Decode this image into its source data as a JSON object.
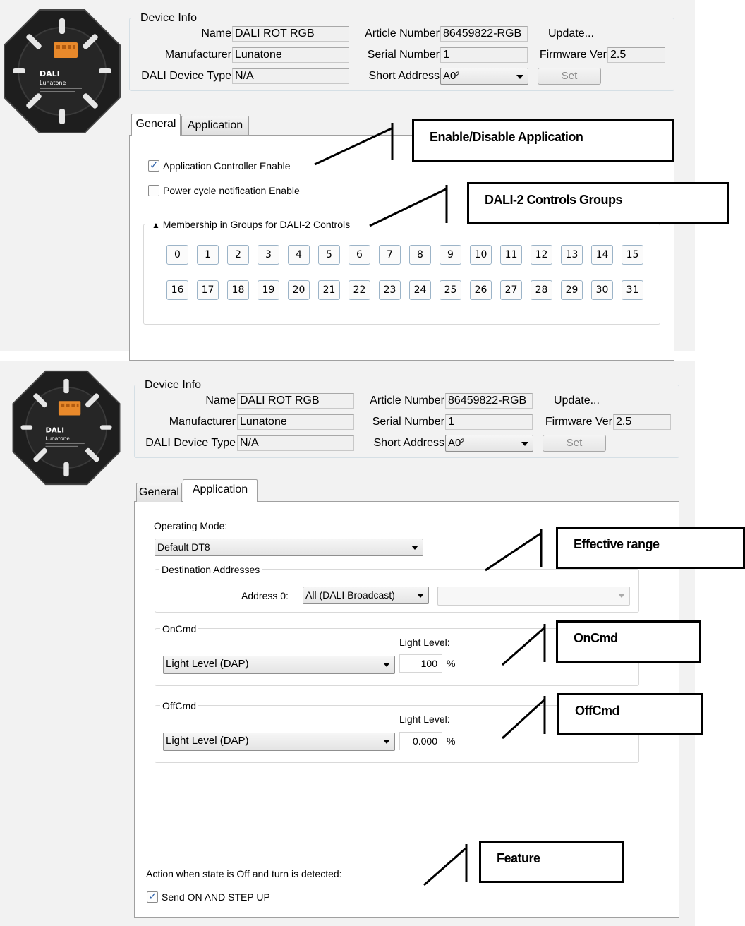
{
  "device_info": {
    "legend": "Device Info",
    "name_label": "Name",
    "name_value": "DALI ROT RGB",
    "manufacturer_label": "Manufacturer",
    "manufacturer_value": "Lunatone",
    "device_type_label": "DALI Device Type",
    "device_type_value": "N/A",
    "article_label": "Article Number",
    "article_value": "86459822-RGB",
    "serial_label": "Serial Number",
    "serial_value": "1",
    "short_address_label": "Short Address",
    "short_address_value": "A0²",
    "update_label": "Update...",
    "firmware_label": "Firmware Ver",
    "firmware_value": "2.5",
    "set_label": "Set"
  },
  "tabs": {
    "general": "General",
    "application": "Application"
  },
  "panel1": {
    "app_controller_enable": {
      "label": "Application Controller Enable",
      "checked": true
    },
    "power_cycle_enable": {
      "label": "Power cycle notification Enable",
      "checked": false
    },
    "groups_legend_arrow": "▲",
    "groups_legend": "Membership in Groups for DALI-2 Controls",
    "groups": [
      "0",
      "1",
      "2",
      "3",
      "4",
      "5",
      "6",
      "7",
      "8",
      "9",
      "10",
      "11",
      "12",
      "13",
      "14",
      "15",
      "16",
      "17",
      "18",
      "19",
      "20",
      "21",
      "22",
      "23",
      "24",
      "25",
      "26",
      "27",
      "28",
      "29",
      "30",
      "31"
    ],
    "annotations": {
      "enable": "Enable/Disable Application",
      "groups": "DALI-2 Controls Groups"
    }
  },
  "panel2": {
    "operating_mode_label": "Operating Mode:",
    "operating_mode_value": "Default DT8",
    "destination_legend": "Destination Addresses",
    "address0_label": "Address 0:",
    "address0_value": "All (DALI Broadcast)",
    "address0_secondary_value": "",
    "oncmd_legend": "OnCmd",
    "oncmd_light_level_label": "Light Level:",
    "oncmd_value": "Light Level (DAP)",
    "oncmd_level": "100",
    "oncmd_unit": "%",
    "offcmd_legend": "OffCmd",
    "offcmd_light_level_label": "Light Level:",
    "offcmd_value": "Light Level (DAP)",
    "offcmd_level": "0.000",
    "offcmd_unit": "%",
    "action_label": "Action when state is Off and turn is detected:",
    "send_on_step_up": {
      "label": "Send ON AND STEP UP",
      "checked": true
    },
    "annotations": {
      "effective": "Effective range",
      "oncmd": "OnCmd",
      "offcmd": "OffCmd",
      "feature": "Feature"
    }
  },
  "device_image": {
    "brand_text": "DALI",
    "maker_text": "Lunatone",
    "connector_color": "#e8892b",
    "body_color": "#1e1e1e"
  }
}
